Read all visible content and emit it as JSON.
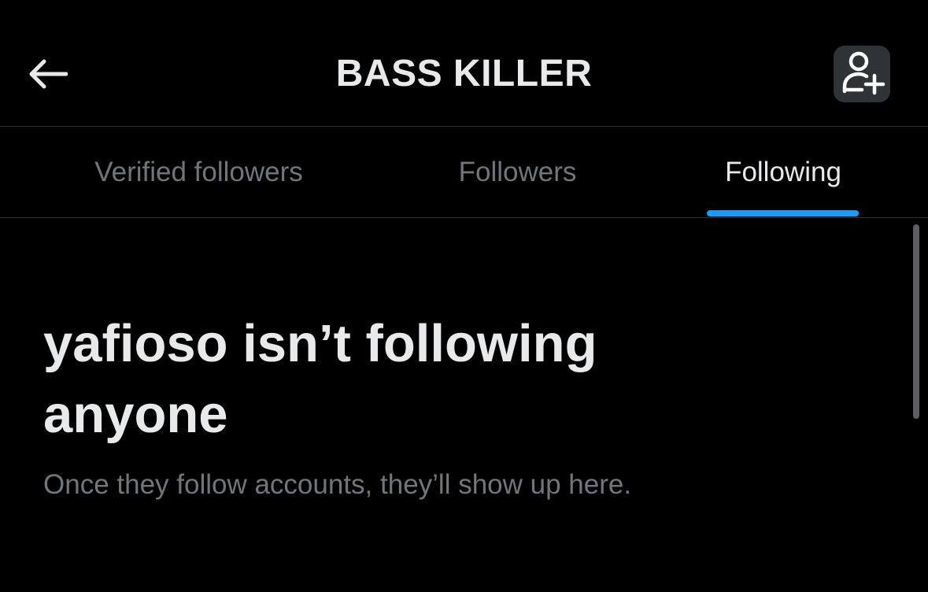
{
  "header": {
    "title": "BASS KILLER",
    "back_icon": "arrow-left-icon",
    "add_user_icon": "person-add-icon"
  },
  "tabs": [
    {
      "label": "Verified followers",
      "active": false
    },
    {
      "label": "Followers",
      "active": false
    },
    {
      "label": "Following",
      "active": true
    }
  ],
  "empty_state": {
    "title": "yafioso isn’t following anyone",
    "subtitle": "Once they follow accounts, they’ll show up here."
  },
  "colors": {
    "background": "#000000",
    "text_primary": "#e7e9ea",
    "text_secondary": "#71767b",
    "accent": "#1d9bf0",
    "divider": "#2f3336"
  }
}
